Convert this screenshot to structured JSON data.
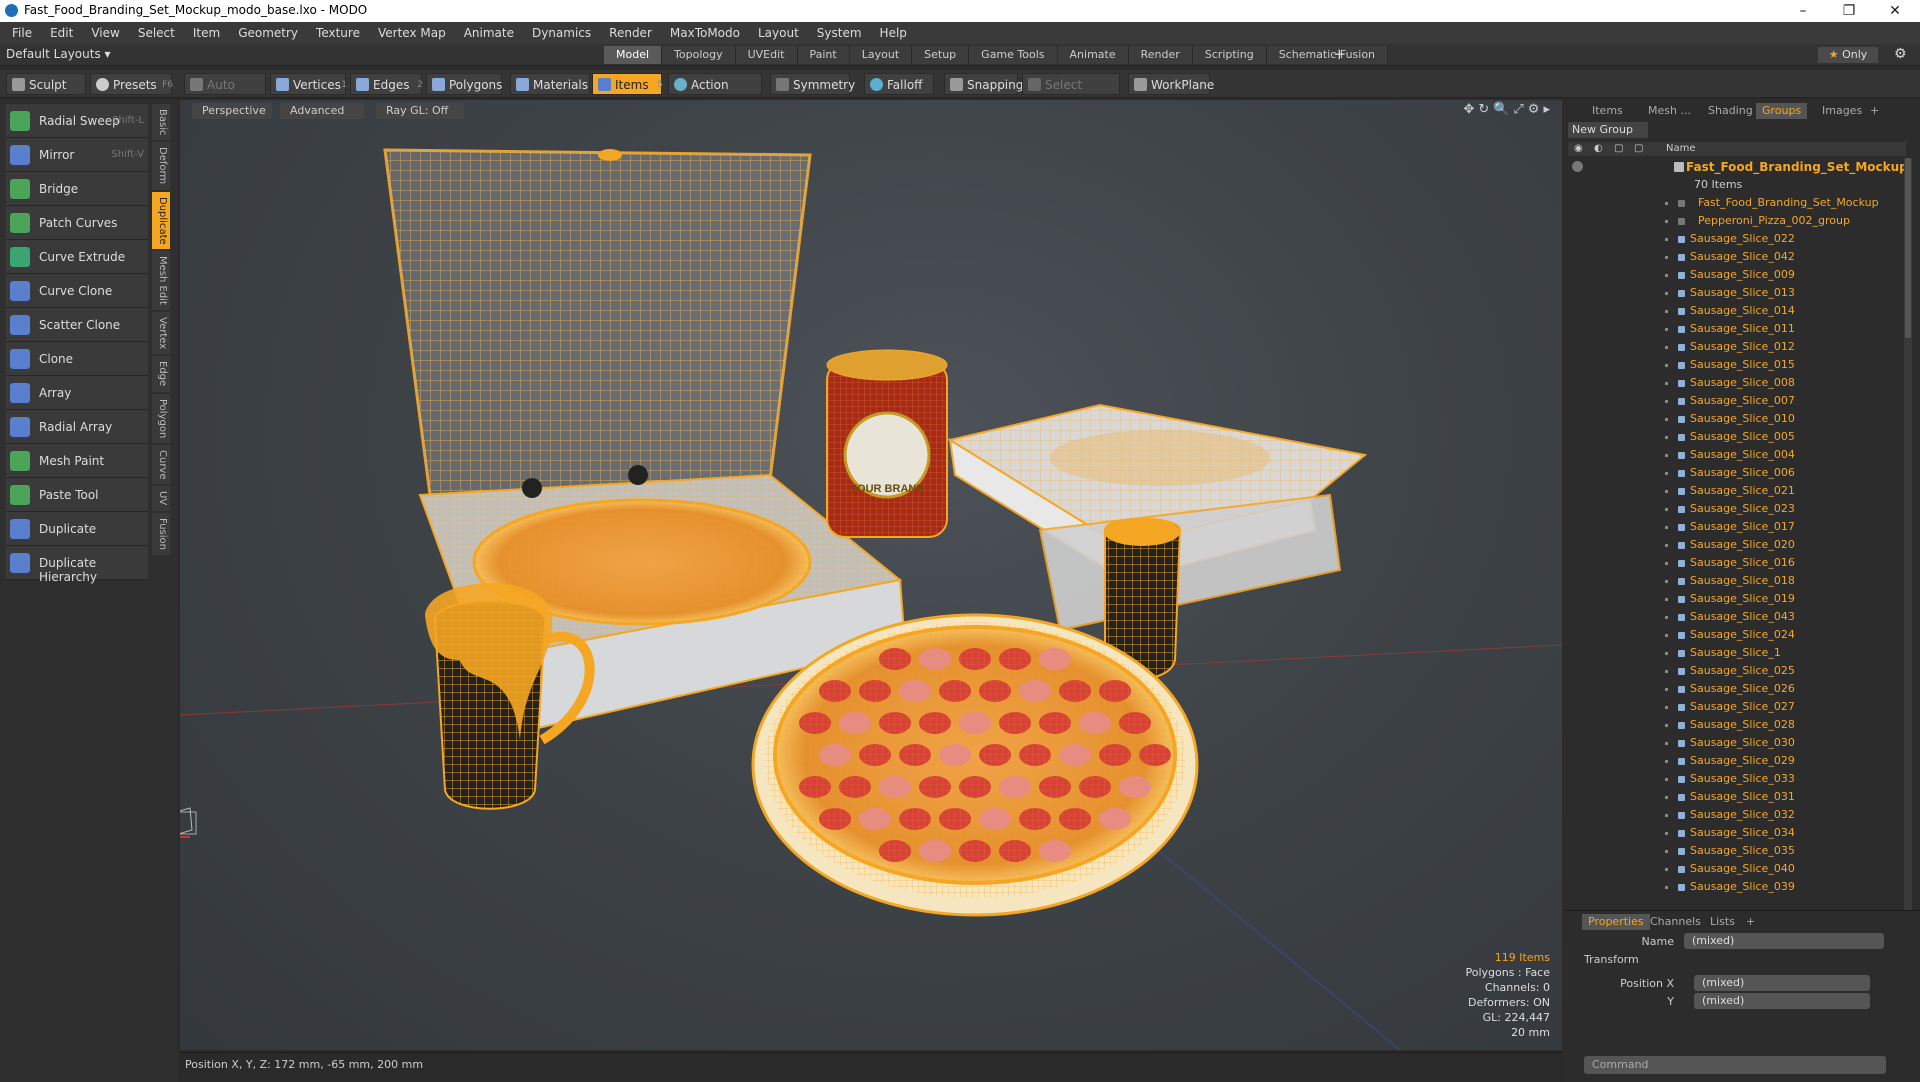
{
  "window": {
    "title": "Fast_Food_Branding_Set_Mockup_modo_base.lxo - MODO",
    "controls": [
      "–",
      "❐",
      "✕"
    ]
  },
  "menu": [
    "File",
    "Edit",
    "View",
    "Select",
    "Item",
    "Geometry",
    "Texture",
    "Vertex Map",
    "Animate",
    "Dynamics",
    "Render",
    "MaxToModo",
    "Layout",
    "System",
    "Help"
  ],
  "layout": {
    "selector": "Default Layouts ▾",
    "tabs": [
      "Model",
      "Topology",
      "UVEdit",
      "Paint",
      "Layout",
      "Setup",
      "Game Tools",
      "Animate",
      "Render",
      "Scripting",
      "Schematic Fusion"
    ],
    "active_tab": "Model",
    "only_label": "Only"
  },
  "toolbar": {
    "sculpt": "Sculpt",
    "presets": "Presets",
    "presets_key": "F6",
    "auto_select": "Auto Select",
    "vertices": "Vertices",
    "vertices_key": "1",
    "edges": "Edges",
    "edges_key": "2",
    "polygons": "Polygons",
    "materials": "Materials",
    "items": "Items",
    "items_key": "5",
    "action_center": "Action Center",
    "symmetry": "Symmetry",
    "falloff": "Falloff",
    "snapping": "Snapping",
    "select_through": "Select Through",
    "workplane": "WorkPlane"
  },
  "tools": [
    {
      "label": "Radial Sweep",
      "key": "Shift-L",
      "color": "#4aa55a"
    },
    {
      "label": "Mirror",
      "key": "Shift-V",
      "color": "#5b7fcf"
    },
    {
      "label": "Bridge",
      "key": "",
      "color": "#4aa55a"
    },
    {
      "label": "Patch Curves",
      "key": "",
      "color": "#4aa55a"
    },
    {
      "label": "Curve Extrude",
      "key": "",
      "color": "#3aa570"
    },
    {
      "label": "Curve Clone",
      "key": "",
      "color": "#5b7fcf"
    },
    {
      "label": "Scatter Clone",
      "key": "",
      "color": "#5b7fcf"
    },
    {
      "label": "Clone",
      "key": "",
      "color": "#5b7fcf"
    },
    {
      "label": "Array",
      "key": "",
      "color": "#5b7fcf"
    },
    {
      "label": "Radial Array",
      "key": "",
      "color": "#5b7fcf"
    },
    {
      "label": "Mesh Paint",
      "key": "",
      "color": "#4aa55a"
    },
    {
      "label": "Paste Tool",
      "key": "",
      "color": "#4aa55a"
    },
    {
      "label": "Duplicate",
      "key": "",
      "color": "#5b7fcf"
    },
    {
      "label": "Duplicate Hierarchy",
      "key": "",
      "color": "#5b7fcf"
    }
  ],
  "side_tabs": [
    "Basic",
    "Deform",
    "Duplicate",
    "Mesh Edit",
    "Vertex",
    "Edge",
    "Polygon",
    "Curve",
    "UV",
    "Fusion"
  ],
  "viewport": {
    "view": "Perspective",
    "advanced": "Advanced",
    "raygl": "Ray GL: Off",
    "info": {
      "items": "119 Items",
      "polygons": "Polygons : Face",
      "channels": "Channels: 0",
      "deformers": "Deformers: ON",
      "gl": "GL: 224,447",
      "scale": "20 mm"
    },
    "brand_text": "YOUR BRAND"
  },
  "status": {
    "position": "Position X, Y, Z:   172 mm, -65 mm, 200 mm"
  },
  "panel": {
    "tabs": [
      "Items",
      "Mesh ...",
      "Shading",
      "Groups",
      "Images"
    ],
    "active_tab": "Groups",
    "new_group": "New Group",
    "column_name": "Name",
    "root": "Fast_Food_Branding_Set_Mockup...",
    "root_count": "70 Items",
    "groups": [
      "Fast_Food_Branding_Set_Mockup",
      "Pepperoni_Pizza_002_group"
    ],
    "items": [
      "Sausage_Slice_022",
      "Sausage_Slice_042",
      "Sausage_Slice_009",
      "Sausage_Slice_013",
      "Sausage_Slice_014",
      "Sausage_Slice_011",
      "Sausage_Slice_012",
      "Sausage_Slice_015",
      "Sausage_Slice_008",
      "Sausage_Slice_007",
      "Sausage_Slice_010",
      "Sausage_Slice_005",
      "Sausage_Slice_004",
      "Sausage_Slice_006",
      "Sausage_Slice_021",
      "Sausage_Slice_023",
      "Sausage_Slice_017",
      "Sausage_Slice_020",
      "Sausage_Slice_016",
      "Sausage_Slice_018",
      "Sausage_Slice_019",
      "Sausage_Slice_043",
      "Sausage_Slice_024",
      "Sausage_Slice_1",
      "Sausage_Slice_025",
      "Sausage_Slice_026",
      "Sausage_Slice_027",
      "Sausage_Slice_028",
      "Sausage_Slice_030",
      "Sausage_Slice_029",
      "Sausage_Slice_033",
      "Sausage_Slice_031",
      "Sausage_Slice_032",
      "Sausage_Slice_034",
      "Sausage_Slice_035",
      "Sausage_Slice_040",
      "Sausage_Slice_039"
    ]
  },
  "properties": {
    "tabs": [
      "Properties",
      "Channels",
      "Lists"
    ],
    "active_tab": "Properties",
    "name_label": "Name",
    "name_value": "(mixed)",
    "section": "Transform",
    "pos_x_label": "Position X",
    "pos_x_value": "(mixed)",
    "pos_y_label": "Y",
    "pos_y_value": "(mixed)",
    "command_placeholder": "Command"
  },
  "colors": {
    "accent": "#f5a623",
    "wire": "#f5a623"
  }
}
